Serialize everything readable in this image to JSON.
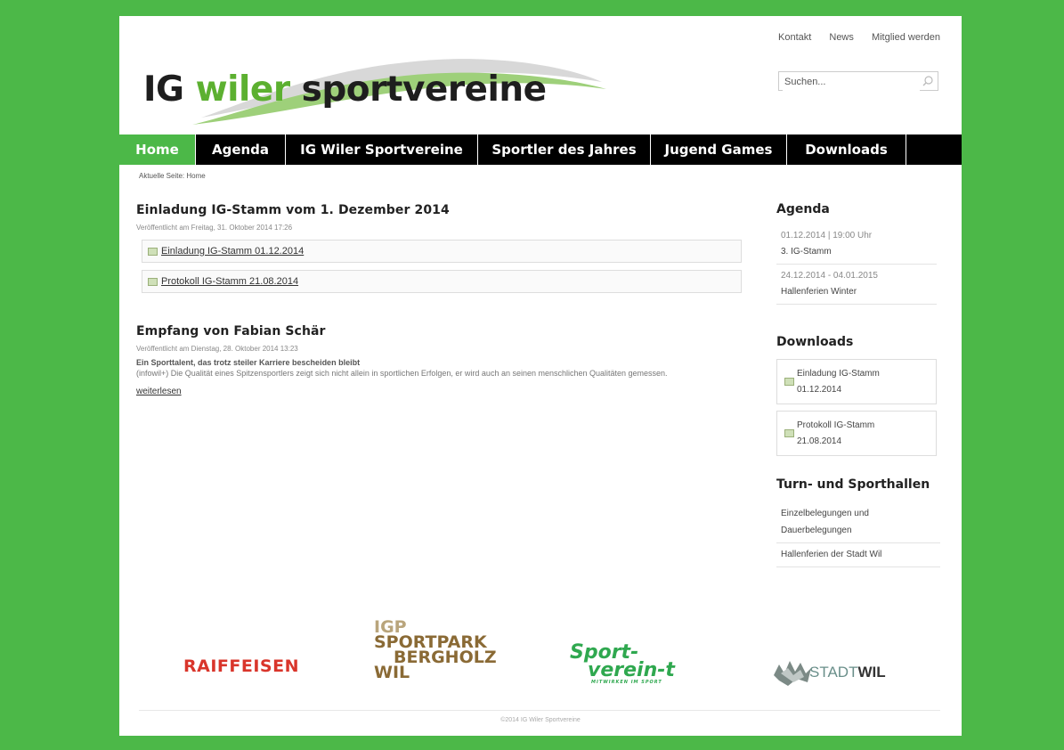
{
  "site": {
    "logo_part1": "IG ",
    "logo_part2": "wiler",
    "logo_part3": " sportvereine"
  },
  "toplinks": [
    "Kontakt",
    "News",
    "Mitglied werden"
  ],
  "search": {
    "placeholder": "Suchen..."
  },
  "nav": [
    {
      "label": "Home",
      "active": true
    },
    {
      "label": "Agenda"
    },
    {
      "label": "IG Wiler Sportvereine"
    },
    {
      "label": "Sportler des Jahres"
    },
    {
      "label": "Jugend Games"
    },
    {
      "label": "Downloads"
    }
  ],
  "breadcrumb": "Aktuelle Seite: Home",
  "articles": [
    {
      "title": "Einladung IG-Stamm vom 1. Dezember 2014",
      "meta": "Veröffentlicht am Freitag, 31. Oktober 2014 17:26",
      "attachments": [
        "Einladung IG-Stamm 01.12.2014",
        "Protokoll IG-Stamm 21.08.2014"
      ]
    },
    {
      "title": "Empfang von Fabian Schär",
      "meta": "Veröffentlicht am Dienstag, 28. Oktober 2014 13:23",
      "lead": "Ein Sporttalent, das trotz steiler Karriere bescheiden bleibt",
      "body": "(infowil+) Die Qualität eines Spitzensportlers zeigt sich nicht allein in sportlichen Erfolgen, er wird auch an seinen menschlichen Qualitäten gemessen.",
      "readmore": "weiterlesen"
    }
  ],
  "sidebar": {
    "agenda_title": "Agenda",
    "agenda": [
      {
        "date": "01.12.2014 | 19:00 Uhr",
        "name": "3. IG-Stamm"
      },
      {
        "date": "24.12.2014 - 04.01.2015",
        "name": "Hallenferien Winter"
      }
    ],
    "downloads_title": "Downloads",
    "downloads": [
      {
        "line1": "Einladung IG-Stamm",
        "line2": "01.12.2014"
      },
      {
        "line1": "Protokoll IG-Stamm",
        "line2": "21.08.2014"
      }
    ],
    "halls_title": "Turn- und Sporthallen",
    "halls": [
      "Einzelbelegungen und Dauerbelegungen",
      "Hallenferien der Stadt Wil"
    ]
  },
  "sponsors": {
    "raiffeisen": "RAIFFEISEN",
    "igp": [
      "IGP",
      "SPORTPARK",
      "BERGHOLZ",
      "WIL"
    ],
    "sportvereint": [
      "Sport-",
      "verein-t",
      "MITWIRKEN IM SPORT"
    ],
    "stadtwil": [
      "STADT",
      "WIL"
    ]
  },
  "footer": "©2014 IG Wiler Sportvereine",
  "colors": {
    "green": "#4cb848",
    "nav_bg": "#000000",
    "logo_green": "#5cb030"
  }
}
